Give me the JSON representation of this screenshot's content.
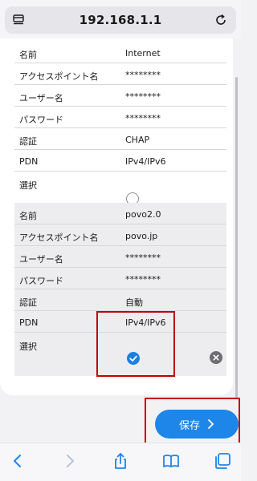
{
  "browser": {
    "url": "192.168.1.1",
    "icons": {
      "reader": "reader-mode-icon",
      "reload": "reload-icon"
    }
  },
  "apn_profiles": [
    {
      "rows": [
        {
          "label": "名前",
          "value": "Internet"
        },
        {
          "label": "アクセスポイント名",
          "value": "********"
        },
        {
          "label": "ユーザー名",
          "value": "********"
        },
        {
          "label": "パスワード",
          "value": "********"
        },
        {
          "label": "認証",
          "value": "CHAP"
        },
        {
          "label": "PDN",
          "value": "IPv4/IPv6"
        }
      ],
      "select_label": "選択",
      "selected": false
    },
    {
      "rows": [
        {
          "label": "名前",
          "value": "povo2.0"
        },
        {
          "label": "アクセスポイント名",
          "value": "povo.jp"
        },
        {
          "label": "ユーザー名",
          "value": "********"
        },
        {
          "label": "パスワード",
          "value": "********"
        },
        {
          "label": "認証",
          "value": "自動"
        },
        {
          "label": "PDN",
          "value": "IPv4/IPv6"
        }
      ],
      "select_label": "選択",
      "selected": true
    }
  ],
  "save_button": {
    "label": "保存"
  },
  "toolbar": {
    "items": [
      "back-icon",
      "forward-icon",
      "share-icon",
      "bookmarks-icon",
      "tabs-icon"
    ]
  },
  "colors": {
    "accent": "#1d86e8",
    "highlight": "#c00000",
    "selected_group_bg": "#ededef"
  }
}
